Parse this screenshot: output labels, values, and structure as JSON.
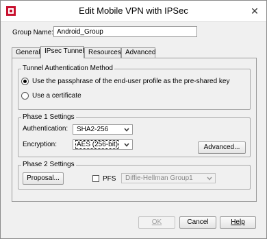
{
  "window": {
    "title": "Edit Mobile VPN with IPSec",
    "close_glyph": "✕"
  },
  "group_name": {
    "label": "Group Name:",
    "value": "Android_Group"
  },
  "tabs": [
    {
      "label": "General",
      "active": false
    },
    {
      "label": "IPsec Tunnel",
      "active": true
    },
    {
      "label": "Resources",
      "active": false
    },
    {
      "label": "Advanced",
      "active": false
    }
  ],
  "tunnel_auth": {
    "title": "Tunnel Authentication Method",
    "option_passphrase": "Use the passphrase of the end-user profile as the pre-shared key",
    "option_certificate": "Use a certificate",
    "selected": "passphrase"
  },
  "phase1": {
    "title": "Phase 1 Settings",
    "auth_label": "Authentication:",
    "auth_value": "SHA2-256",
    "enc_label": "Encryption:",
    "enc_value": "AES (256-bit)",
    "advanced_button": "Advanced..."
  },
  "phase2": {
    "title": "Phase 2 Settings",
    "proposal_button": "Proposal...",
    "pfs_label": "PFS",
    "pfs_checked": false,
    "dh_value": "Diffie-Hellman Group1"
  },
  "footer": {
    "ok_label": "OK",
    "cancel_label": "Cancel",
    "help_label": "Help"
  },
  "icons": {
    "app": "watchguard-logo-icon",
    "close": "close-icon",
    "dropdown": "chevron-down-icon"
  },
  "colors": {
    "brand_red": "#c8102e"
  }
}
